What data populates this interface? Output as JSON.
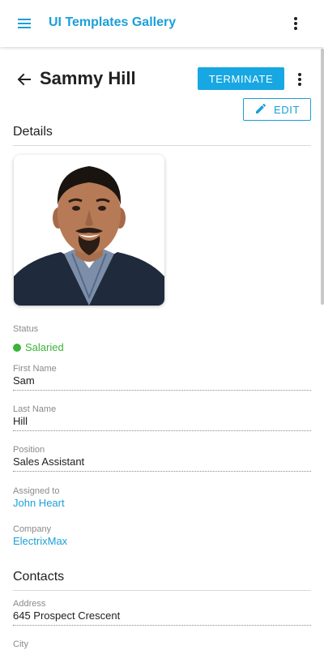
{
  "appbar": {
    "title": "UI Templates Gallery",
    "menu_icon": "menu-icon",
    "more_icon": "more-vertical-icon"
  },
  "header": {
    "name": "Sammy Hill",
    "terminate_label": "TERMINATE",
    "edit_label": "EDIT"
  },
  "details": {
    "section_title": "Details",
    "status_label": "Status",
    "status_value": "Salaried",
    "status_color": "#3bb33b",
    "fields": [
      {
        "label": "First Name",
        "value": "Sam"
      },
      {
        "label": "Last Name",
        "value": "Hill"
      },
      {
        "label": "Position",
        "value": "Sales Assistant"
      }
    ],
    "assigned_label": "Assigned to",
    "assigned_value": "John Heart",
    "company_label": "Company",
    "company_value": "ElectrixMax"
  },
  "contacts": {
    "section_title": "Contacts",
    "address_label": "Address",
    "address_value": "645 Prospect Crescent",
    "city_label": "City"
  },
  "colors": {
    "accent": "#1a9fd9",
    "primary_button": "#17a7e2",
    "success": "#3bb33b"
  }
}
